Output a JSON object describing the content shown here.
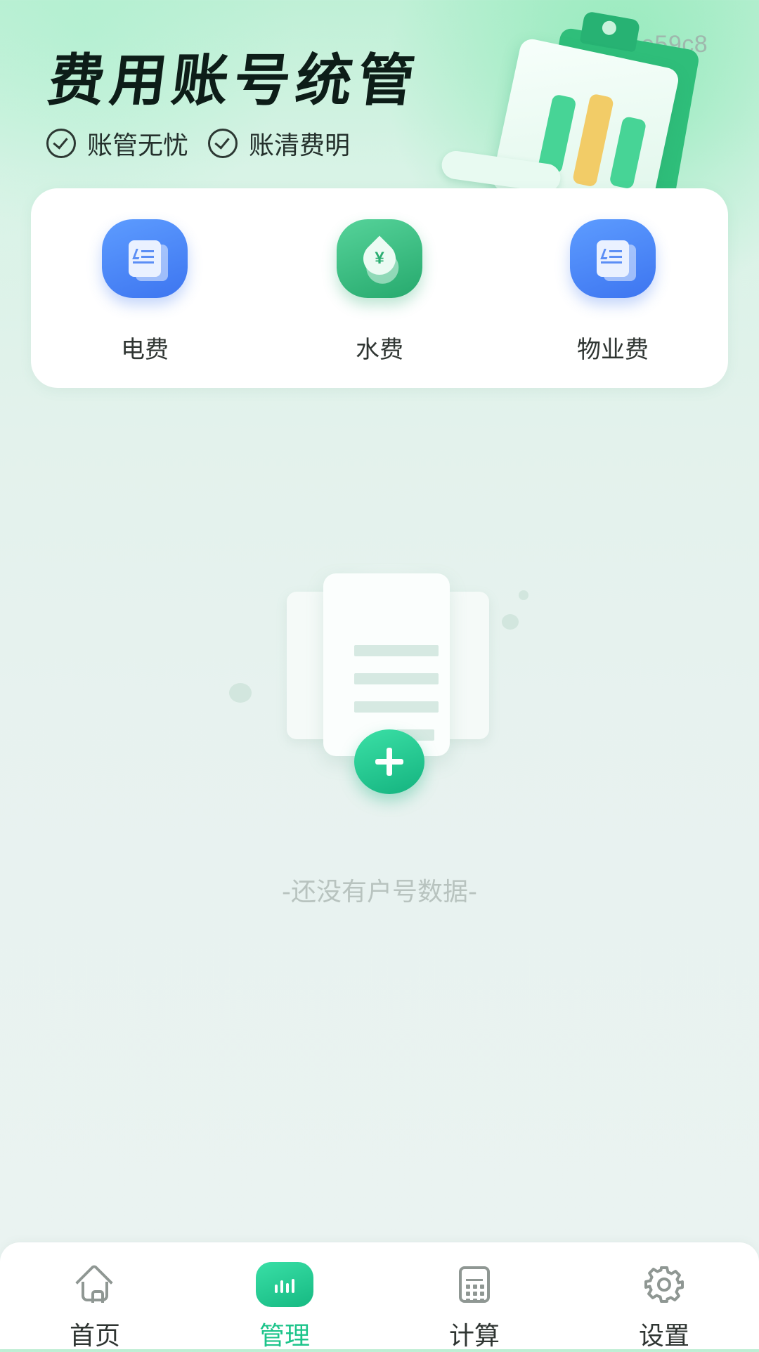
{
  "watermark": "e59c8",
  "banner": {
    "title": "费用账号统管",
    "tags": [
      "账管无忧",
      "账清费明"
    ]
  },
  "fee_types": [
    {
      "label": "电费",
      "icon": "electricity-bill-icon",
      "color": "#4a86f7"
    },
    {
      "label": "水费",
      "icon": "water-bill-icon",
      "color": "#2fb877"
    },
    {
      "label": "物业费",
      "icon": "property-bill-icon",
      "color": "#4a86f7"
    }
  ],
  "empty_state": {
    "text": "-还没有户号数据-"
  },
  "tab_bar": {
    "active": "管理",
    "accent_color": "#1cc48a",
    "tabs": [
      {
        "label": "首页",
        "icon": "home-icon"
      },
      {
        "label": "管理",
        "icon": "chart-icon"
      },
      {
        "label": "计算",
        "icon": "calculator-icon"
      },
      {
        "label": "设置",
        "icon": "gear-icon"
      }
    ]
  }
}
